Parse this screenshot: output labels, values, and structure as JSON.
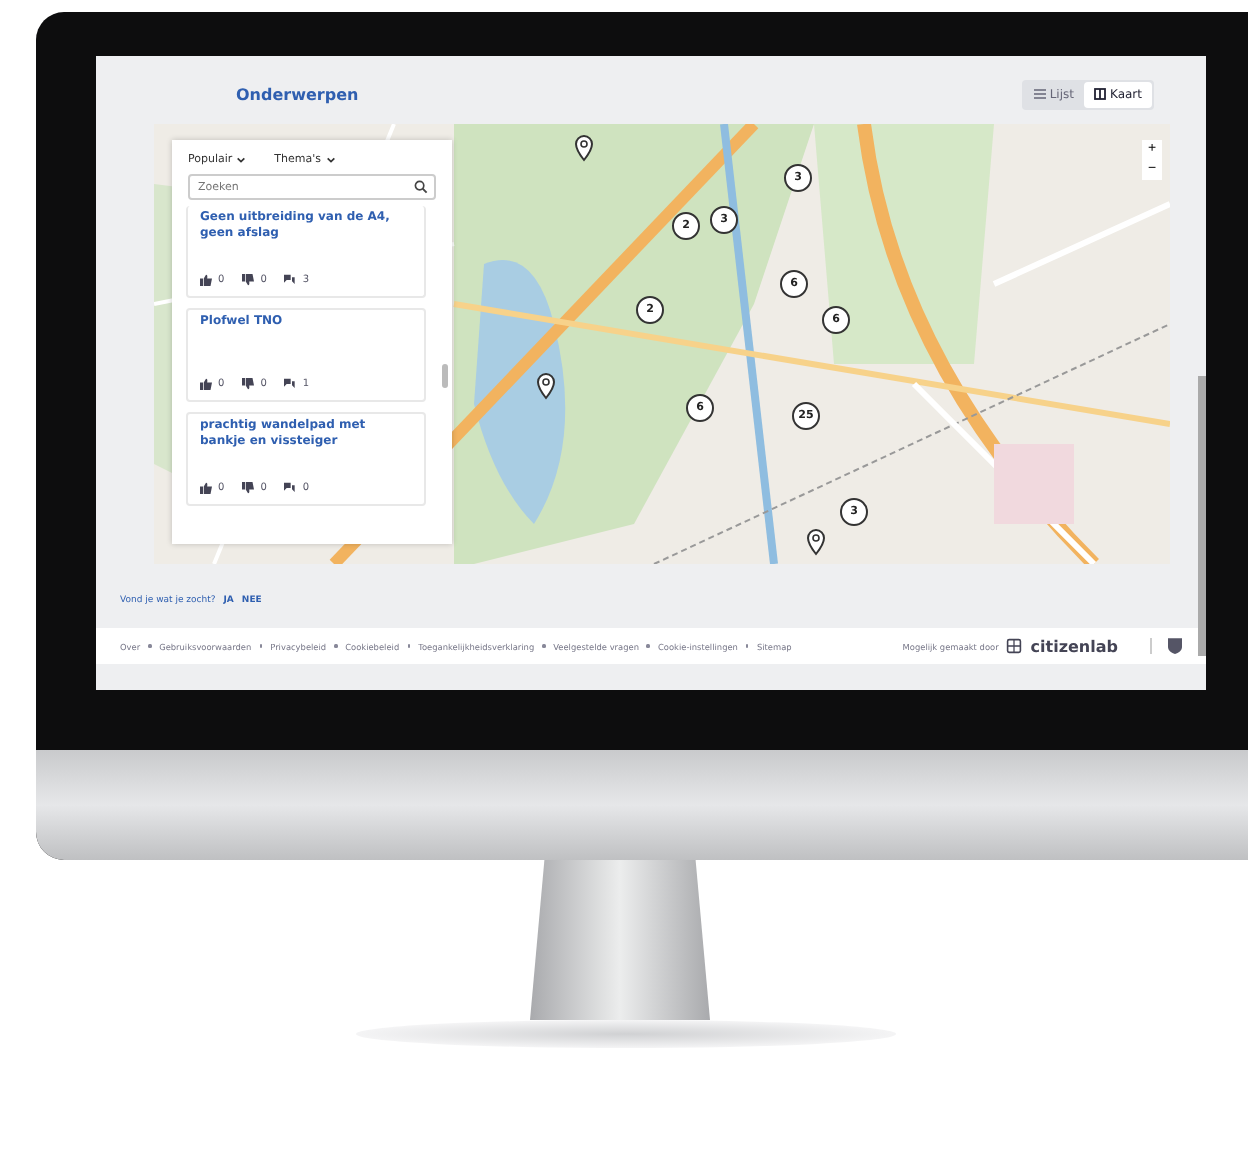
{
  "header": {
    "title": "Onderwerpen",
    "view_toggle": [
      {
        "label": "Lijst",
        "selected": false
      },
      {
        "label": "Kaart",
        "selected": true
      }
    ]
  },
  "filters": [
    {
      "label": "Populair"
    },
    {
      "label": "Thema's"
    }
  ],
  "search": {
    "placeholder": "Zoeken"
  },
  "ideas": [
    {
      "title": "Geen uitbreiding van de A4, geen afslag",
      "likes": "0",
      "dislikes": "0",
      "comments": "3"
    },
    {
      "title": "Plofwel TNO",
      "likes": "0",
      "dislikes": "0",
      "comments": "1"
    },
    {
      "title": "prachtig wandelpad met bankje en vissteiger",
      "likes": "0",
      "dislikes": "0",
      "comments": "0"
    }
  ],
  "map": {
    "zoom_in": "+",
    "zoom_out": "−",
    "clusters": [
      {
        "count": "3"
      },
      {
        "count": "2"
      },
      {
        "count": "3"
      },
      {
        "count": "6"
      },
      {
        "count": "2"
      },
      {
        "count": "6"
      },
      {
        "count": "6"
      },
      {
        "count": "25"
      },
      {
        "count": "3"
      }
    ]
  },
  "feedback": {
    "question": "Vond je wat je zocht?",
    "yes": "JA",
    "no": "NEE"
  },
  "footer": {
    "links": [
      "Over",
      "Gebruiksvoorwaarden",
      "Privacybeleid",
      "Cookiebeleid",
      "Toegankelijkheidsverklaring",
      "Veelgestelde vragen",
      "Cookie-instellingen",
      "Sitemap"
    ],
    "powered_by": "Mogelijk gemaakt door",
    "brand": "citizenlab"
  }
}
